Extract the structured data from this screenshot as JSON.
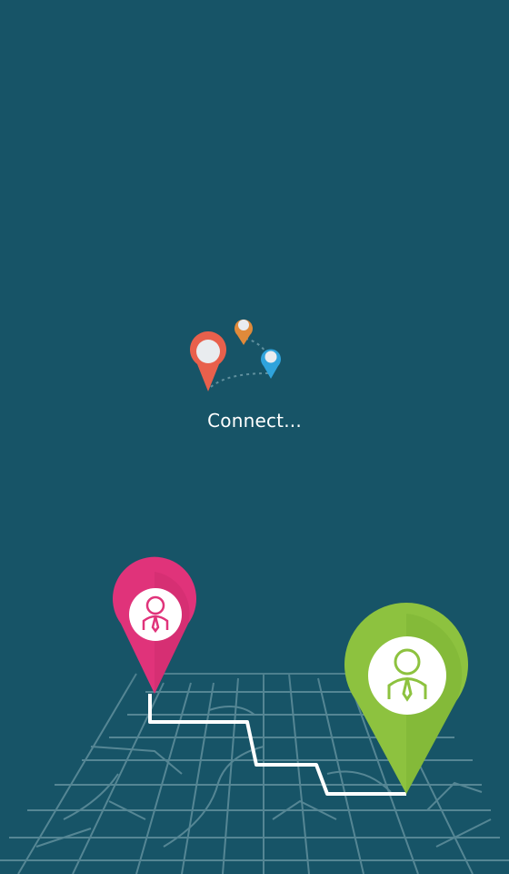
{
  "status": {
    "label": "Connect..."
  },
  "colors": {
    "background": "#175467",
    "pin_red": "#E8604C",
    "pin_orange": "#E08A3A",
    "pin_blue": "#2FA3DC",
    "pin_pink": "#E0337A",
    "pin_green": "#8DC23F",
    "route": "#FFFFFF",
    "streets": "#5F8E9C"
  },
  "icons": {
    "logo": "location-pins-logo-icon",
    "start_pin": "person-pin-icon",
    "end_pin": "person-pin-icon"
  }
}
